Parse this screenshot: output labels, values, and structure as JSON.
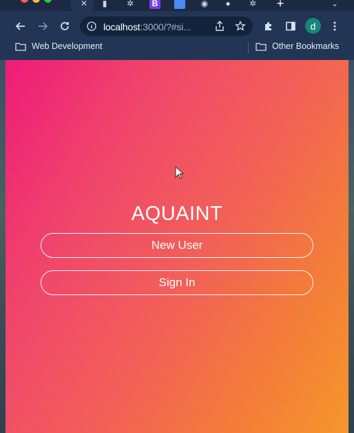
{
  "browser": {
    "url_host": "localhost",
    "url_rest": ":3000/?#si...",
    "profile_initial": "d",
    "bookmarks": {
      "left_folder": "Web Development",
      "right_folder": "Other Bookmarks"
    }
  },
  "app": {
    "title": "AQUAINT",
    "new_user_label": "New User",
    "sign_in_label": "Sign In"
  }
}
